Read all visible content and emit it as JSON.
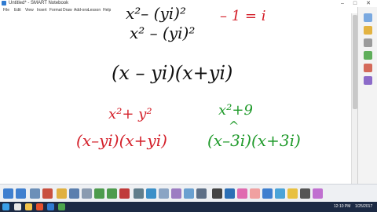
{
  "window": {
    "title": "Untitled* - SMART Notebook",
    "controls": {
      "minimize": "–",
      "maximize": "□",
      "close": "✕"
    }
  },
  "menu": {
    "items": [
      "File",
      "Edit",
      "View",
      "Insert",
      "Format",
      "Draw",
      "Add-ons",
      "Lesson",
      "Help"
    ]
  },
  "canvas": {
    "black_lines": [
      "x²– (yi)²",
      "x² – (yi)²",
      "(x – yi)(x+yi)"
    ],
    "red_top": "– 1 = i",
    "red_expression": "x²+ y²",
    "red_factored": "(x–yi)(x+yi)",
    "green_expression": "x²+9",
    "green_caret": "^",
    "green_factored": "(x–3i)(x+3i)",
    "colors": {
      "black": "#111111",
      "red": "#d4202a",
      "green": "#1f9a2a"
    }
  },
  "sidebar": {
    "icons": [
      "page-sorter-icon",
      "gallery-icon",
      "attachments-icon",
      "properties-icon",
      "add-ons-icon",
      "lesson-icon"
    ]
  },
  "toolbar": {
    "icons": [
      "back-icon",
      "forward-icon",
      "add-page-icon",
      "delete-page-icon",
      "open-icon",
      "save-icon",
      "paste-icon",
      "undo-icon",
      "redo-icon",
      "delete-icon",
      "screen-shade-icon",
      "full-screen-icon",
      "dual-page-icon",
      "camera-icon",
      "table-icon",
      "document-camera-icon",
      "select-icon",
      "pen-icon",
      "creative-pen-icon",
      "eraser-icon",
      "line-icon",
      "shapes-icon",
      "fill-icon",
      "text-icon",
      "magic-pen-icon"
    ]
  },
  "taskbar": {
    "time": "12:10 PM",
    "date": "1/25/2017"
  }
}
